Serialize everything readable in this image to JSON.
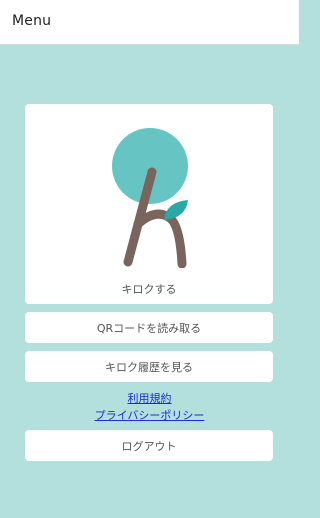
{
  "header": {
    "title": "Menu"
  },
  "main": {
    "kiroku_card_label": "キロクする",
    "qr_button_label": "QRコードを読み取る",
    "history_button_label": "キロク履歴を見る",
    "terms_link": "利用規約",
    "privacy_link": "プライバシーポリシー",
    "logout_button_label": "ログアウト"
  },
  "colors": {
    "background": "#b3dfdc",
    "logo_circle": "#66c4c2",
    "logo_stroke": "#7a655e",
    "logo_leaf": "#2aa8a4",
    "link": "#1a2fd6"
  }
}
